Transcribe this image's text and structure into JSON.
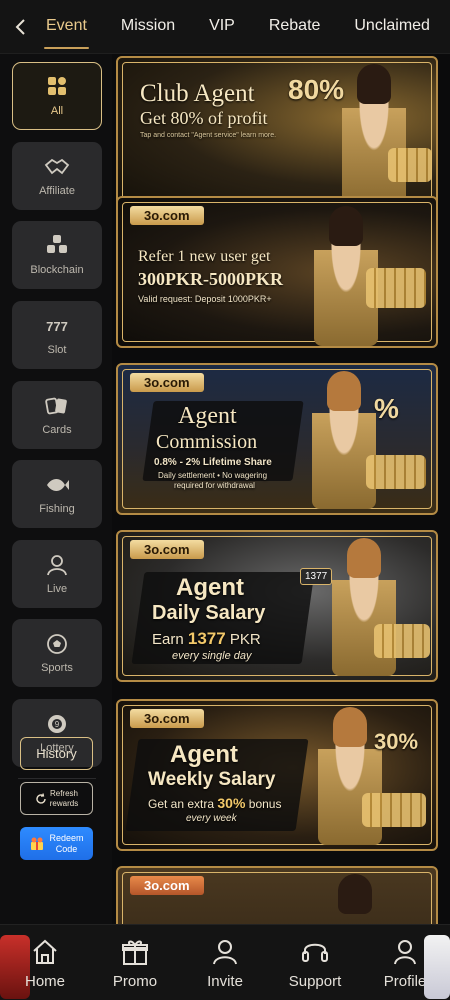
{
  "tabs": [
    "Event",
    "Mission",
    "VIP",
    "Rebate",
    "Unclaimed"
  ],
  "sidebar": {
    "categories": [
      {
        "label": "All",
        "icon": "grid-icon"
      },
      {
        "label": "Affiliate",
        "icon": "handshake-icon"
      },
      {
        "label": "Blockchain",
        "icon": "blockchain-icon"
      },
      {
        "label": "Slot",
        "icon": "slot-777-icon"
      },
      {
        "label": "Cards",
        "icon": "cards-icon"
      },
      {
        "label": "Fishing",
        "icon": "fish-icon"
      },
      {
        "label": "Live",
        "icon": "dealer-icon"
      },
      {
        "label": "Sports",
        "icon": "soccer-ball-icon"
      },
      {
        "label": "Lottery",
        "icon": "lottery-ball-icon"
      }
    ],
    "history_label": "History",
    "refresh_label_1": "Refresh",
    "refresh_label_2": "rewards",
    "redeem_label_1": "Redeem",
    "redeem_label_2": "Code"
  },
  "banners": [
    {
      "title": "Club Agent",
      "subtitle": "Get 80% of profit",
      "note": "Tap and contact \"Agent service\" learn more.",
      "badge": "80%"
    },
    {
      "tag": "3o.com",
      "title": "Refer 1 new user get",
      "amount": "300PKR-5000PKR",
      "note": "Valid request: Deposit 1000PKR+"
    },
    {
      "tag": "3o.com",
      "title_1": "Agent",
      "title_2": "Commission",
      "rate": "0.8% - 2% Lifetime Share",
      "note_1": "Daily settlement • No wagering",
      "note_2": "required for withdrawal",
      "badge": "%"
    },
    {
      "tag": "3o.com",
      "title_1": "Agent",
      "title_2": "Daily Salary",
      "earn_prefix": "Earn",
      "earn_amount": "1377",
      "earn_unit": "PKR",
      "note": "every single day",
      "calendar": "1377"
    },
    {
      "tag": "3o.com",
      "title_1": "Agent",
      "title_2": "Weekly Salary",
      "bonus_prefix": "Get an extra",
      "bonus_pct": "30%",
      "bonus_suffix": "bonus",
      "note": "every week",
      "badge": "30%"
    },
    {
      "tag": "3o.com"
    }
  ],
  "bottom_nav": [
    {
      "label": "Home",
      "icon": "home-icon"
    },
    {
      "label": "Promo",
      "icon": "gift-icon"
    },
    {
      "label": "Invite",
      "icon": "invite-users-icon"
    },
    {
      "label": "Support",
      "icon": "headset-icon"
    },
    {
      "label": "Profile",
      "icon": "user-icon"
    }
  ],
  "colors": {
    "accent_gold": "#d9bf85",
    "active_tab": "#e8c98c",
    "redeem_blue": "#2e8bff",
    "background": "#0b0b0c"
  }
}
